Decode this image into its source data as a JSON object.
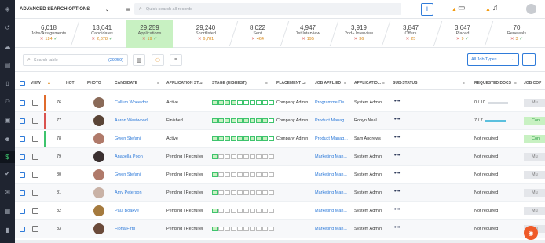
{
  "nav": {
    "icons": [
      "logo-icon",
      "history-icon",
      "cloud-icon",
      "doc-icon",
      "phone-icon",
      "people-icon",
      "briefcase-icon",
      "person-icon",
      "dollar-icon",
      "check-icon",
      "mail-icon",
      "calendar-icon",
      "chart-icon"
    ]
  },
  "topbar": {
    "search_scope": "ADVANCED SEARCH OPTIONS",
    "quick_search_placeholder": "Quick search all records"
  },
  "stages": [
    {
      "num": "6,018",
      "label": "Jobs/Assignments",
      "count": "124"
    },
    {
      "num": "13,641",
      "label": "Candidates",
      "count": "2,378"
    },
    {
      "num": "29,259",
      "label": "Applications",
      "count": "19",
      "selected": true
    },
    {
      "num": "29,240",
      "label": "Shortlisted",
      "count": "6,781"
    },
    {
      "num": "8,022",
      "label": "Sent",
      "count": "464"
    },
    {
      "num": "4,947",
      "label": "1st Interview",
      "count": "195"
    },
    {
      "num": "3,919",
      "label": "2nd+ Interview",
      "count": "36"
    },
    {
      "num": "3,847",
      "label": "Offers",
      "count": "25"
    },
    {
      "num": "3,647",
      "label": "Placed",
      "count": "9"
    },
    {
      "num": "70",
      "label": "Renewals",
      "count": "3"
    }
  ],
  "toolbar": {
    "search_placeholder": "Search table",
    "total": "(29259)",
    "job_types": "All Job Types"
  },
  "columns": {
    "view": "VIEW",
    "hot": "HOT",
    "photo": "PHOTO",
    "candidate": "CANDIDATE",
    "app_status": "APPLICATION ST...",
    "stage": "STAGE (HIGHEST)",
    "placement": "PLACEMENT ...",
    "job_applied": "JOB APPLIED",
    "application": "APPLICATIO...",
    "sub_status": "SUB-STATUS",
    "req_docs": "REQUESTED DOCS",
    "job_cop": "JOB COP"
  },
  "rows": [
    {
      "hot": "76",
      "candidate": "Callum Wheeldon",
      "status": "Active",
      "placement": "Company Admin",
      "job": "Programme De...",
      "app_by": "System Admin",
      "docs": "0 / 10",
      "doc_full": false,
      "jc": "Mu",
      "stage": 4,
      "bar": "#e06b2c",
      "photo": "#8a6a58"
    },
    {
      "hot": "77",
      "candidate": "Aaron Westwood",
      "status": "Finished",
      "placement": "Company Admin",
      "job": "Product Manag...",
      "app_by": "Robyn Neal",
      "docs": "7 / 7",
      "doc_full": true,
      "jc": "Con",
      "stage": 9,
      "bar": "#d9534f",
      "photo": "#5a4436"
    },
    {
      "hot": "78",
      "candidate": "Gwen Stefani",
      "status": "Active",
      "placement": "Company Admin",
      "job": "Product Manag...",
      "app_by": "Sam Andrews",
      "docs": "Not required",
      "jc": "Con",
      "stage": 9,
      "bar": "#3ec46d",
      "photo": "#b07a6a"
    },
    {
      "hot": "79",
      "candidate": "Anabella Poon",
      "status": "Pending | Recruiter",
      "placement": "",
      "job": "Marketing Man...",
      "app_by": "System Admin",
      "docs": "Not required",
      "jc": "Mu",
      "stage": 1,
      "bar": "",
      "photo": "#3a3030"
    },
    {
      "hot": "80",
      "candidate": "Gwen Stefani",
      "status": "Pending | Recruiter",
      "placement": "",
      "job": "Marketing Man...",
      "app_by": "System Admin",
      "docs": "Not required",
      "jc": "Mu",
      "stage": 1,
      "bar": "",
      "photo": "#b07a6a"
    },
    {
      "hot": "81",
      "candidate": "Amy Peterson",
      "status": "Pending | Recruiter",
      "placement": "",
      "job": "Marketing Man...",
      "app_by": "System Admin",
      "docs": "Not required",
      "jc": "Mu",
      "stage": 1,
      "bar": "",
      "photo": "#c9b2a6"
    },
    {
      "hot": "82",
      "candidate": "Paul Boakye",
      "status": "Pending | Recruiter",
      "placement": "",
      "job": "Marketing Man...",
      "app_by": "System Admin",
      "docs": "Not required",
      "jc": "Mu",
      "stage": 1,
      "bar": "",
      "photo": "#a57a3e"
    },
    {
      "hot": "83",
      "candidate": "Fiona Firth",
      "status": "Pending | Recruiter",
      "placement": "",
      "job": "Marketing Man...",
      "app_by": "System Admin",
      "docs": "Not required",
      "jc": "Mu",
      "stage": 1,
      "bar": "",
      "photo": "#6a4a3a"
    }
  ]
}
